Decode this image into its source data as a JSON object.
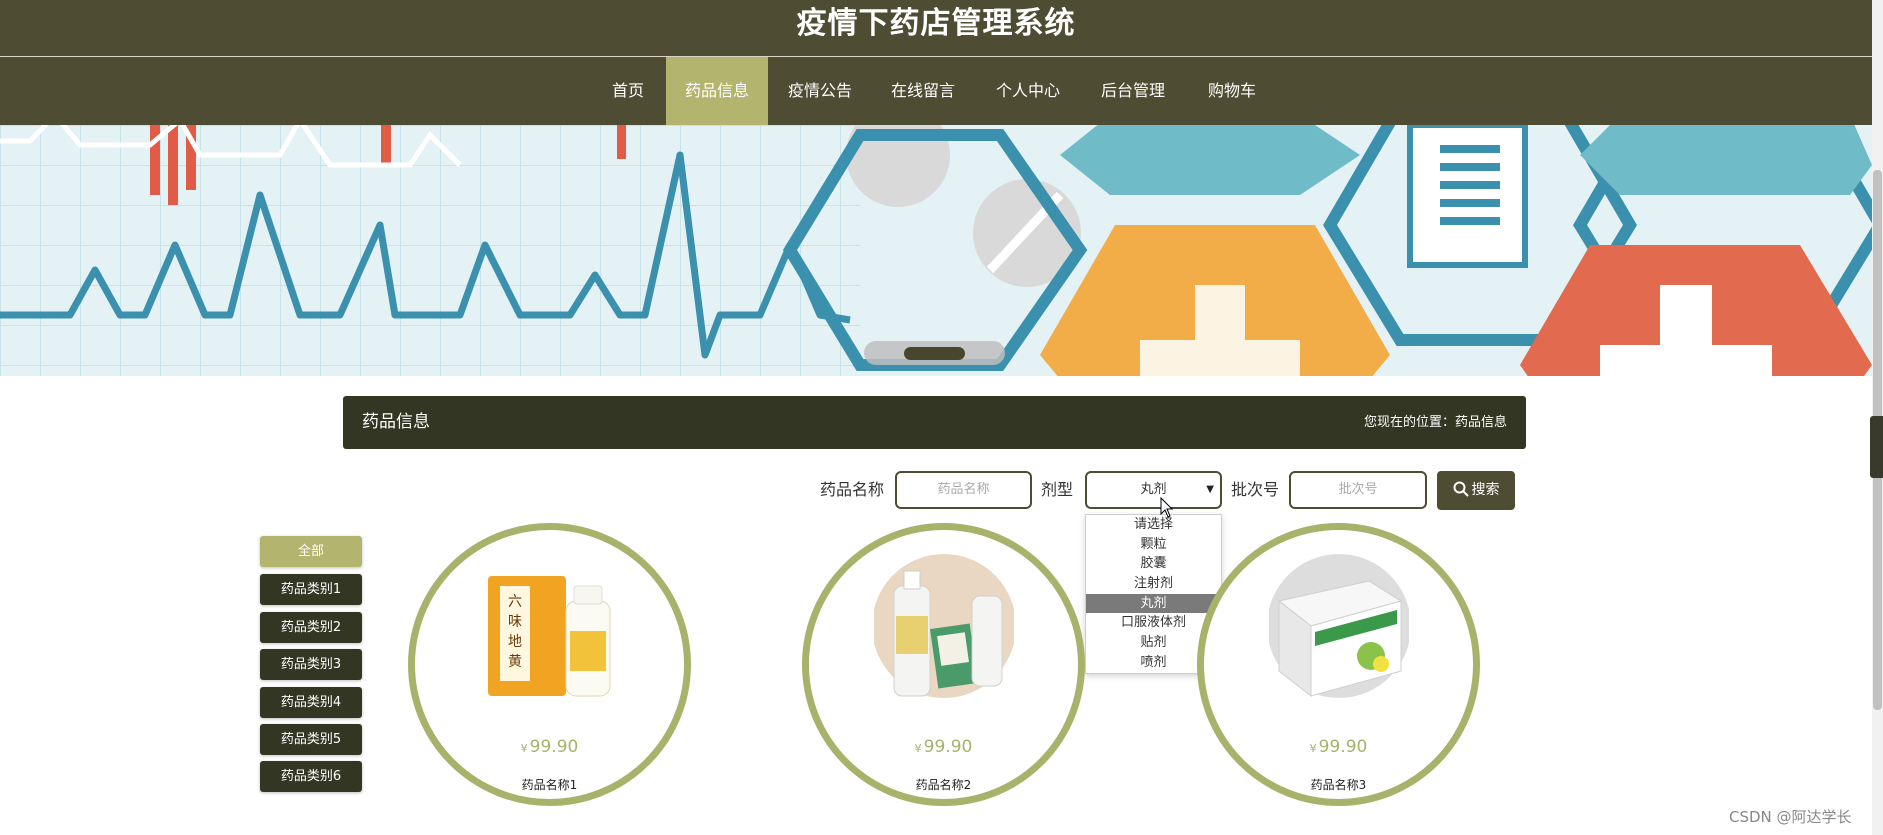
{
  "site": {
    "title": "疫情下药店管理系统"
  },
  "nav": {
    "items": [
      "首页",
      "药品信息",
      "疫情公告",
      "在线留言",
      "个人中心",
      "后台管理",
      "购物车"
    ],
    "active_index": 1
  },
  "section": {
    "title": "药品信息",
    "location": "您现在的位置：药品信息"
  },
  "search": {
    "name_label": "药品名称",
    "name_placeholder": "药品名称",
    "type_label": "剂型",
    "type_value": "丸剂",
    "batch_label": "批次号",
    "batch_placeholder": "批次号",
    "button_label": "搜索"
  },
  "dropdown": {
    "options": [
      "请选择",
      "颗粒",
      "胶囊",
      "注射剂",
      "丸剂",
      "口服液体剂",
      "贴剂",
      "喷剂"
    ],
    "selected_index": 4
  },
  "categories": [
    "全部",
    "药品类别1",
    "药品类别2",
    "药品类别3",
    "药品类别4",
    "药品类别5",
    "药品类别6"
  ],
  "products": [
    {
      "currency": "¥",
      "price": "99.90",
      "name": "药品名称1"
    },
    {
      "currency": "¥",
      "price": "99.90",
      "name": "药品名称2"
    },
    {
      "currency": "¥",
      "price": "99.90",
      "name": "药品名称3"
    }
  ],
  "product_images": [
    "六味地黄丸"
  ],
  "watermark": "CSDN @阿达学长",
  "colors": {
    "header": "#4e4c33",
    "accent": "#b3b56e",
    "dark": "#333623",
    "ring": "#a9b26b"
  }
}
